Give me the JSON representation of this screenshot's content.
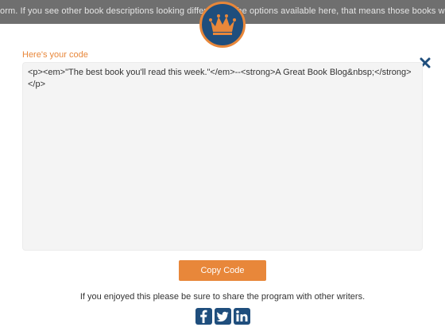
{
  "backdrop": {
    "line1": "orm. If you see other book descriptions looking different, or the options available here, that means those books w",
    "line2": ""
  },
  "modal": {
    "code_label": "Here's your code",
    "code_value": "<p><em>\"The best book you'll read this week.\"</em>--<strong>A Great Book Blog&nbsp;</strong></p>",
    "copy_button": "Copy Code",
    "share_text": "If you enjoyed this please be sure to share the program with other writers.",
    "close_icon": "close-icon",
    "logo_icon": "crown-icon"
  },
  "social": [
    {
      "name": "facebook-icon"
    },
    {
      "name": "twitter-icon"
    },
    {
      "name": "linkedin-icon"
    }
  ],
  "colors": {
    "accent": "#e8873a",
    "navy": "#1f4e7d",
    "code_bg": "#f4f4f4"
  }
}
